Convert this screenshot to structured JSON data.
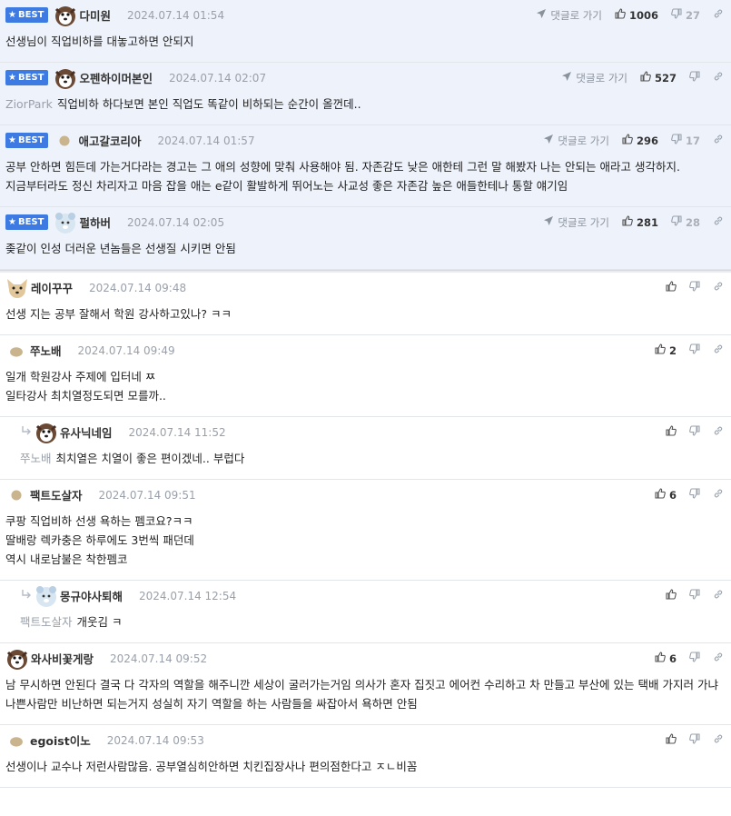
{
  "labels": {
    "best": "BEST",
    "goto": "댓글로 가기"
  },
  "best_comments": [
    {
      "nick": "다미원",
      "date": "2024.07.14 01:54",
      "up": "1006",
      "down": "27",
      "body": "선생님이 직업비하를 대놓고하면 안되지",
      "mention": "",
      "avatar": "dog"
    },
    {
      "nick": "오펜하이머본인",
      "date": "2024.07.14 02:07",
      "up": "527",
      "down": "",
      "body": "직업비하 하다보면 본인 직업도 똑같이 비하되는 순간이 올껀데..",
      "mention": "ZiorPark",
      "avatar": "dog"
    },
    {
      "nick": "애고갈코리아",
      "date": "2024.07.14 01:57",
      "up": "296",
      "down": "17",
      "body": "공부 안하면 힘든데 가는거다라는 경고는 그 애의 성향에 맞춰 사용해야 됨. 자존감도 낮은 애한테 그런 말 해봤자 나는 안되는 애라고 생각하지. 지금부터라도 정신 차리자고 마음 잡을 애는 e같이 활발하게 뛰어노는 사교성 좋은 자존감 높은 애들한테나 통할 얘기임",
      "mention": "",
      "avatar": "blob"
    },
    {
      "nick": "펄하버",
      "date": "2024.07.14 02:05",
      "up": "281",
      "down": "28",
      "body": "좆같이 인성 더러운 년놈들은 선생질 시키면 안됨",
      "mention": "",
      "avatar": "bear"
    }
  ],
  "comments": [
    {
      "nick": "레이꾸꾸",
      "date": "2024.07.14 09:48",
      "up": "",
      "body": "선생 지는 공부 잘해서 학원 강사하고있나? ㅋㅋ",
      "mention": "",
      "reply": false,
      "avatar": "fox"
    },
    {
      "nick": "쭈노배",
      "date": "2024.07.14 09:49",
      "up": "2",
      "body": "일개 학원강사 주제에 입터네 ㅉ\n일타강사 최치열정도되면 모를까..",
      "mention": "",
      "reply": false,
      "avatar": "blob2"
    },
    {
      "nick": "유사닉네임",
      "date": "2024.07.14 11:52",
      "up": "",
      "body": "최치열은 치열이 좋은 편이겠네.. 부럽다",
      "mention": "쭈노배",
      "reply": true,
      "avatar": "dog"
    },
    {
      "nick": "팩트도살자",
      "date": "2024.07.14 09:51",
      "up": "6",
      "body": "쿠팡 직업비하 선생 욕하는 펨코요?ㅋㅋ\n딸배랑 렉카충은 하루에도 3번씩 패던데\n역시 내로남불은 착한펨코",
      "mention": "",
      "reply": false,
      "avatar": "blob"
    },
    {
      "nick": "몽규야사퇴해",
      "date": "2024.07.14 12:54",
      "up": "",
      "body": "개웃김 ㅋ",
      "mention": "팩트도살자",
      "reply": true,
      "avatar": "bear"
    },
    {
      "nick": "와사비꽃게랑",
      "date": "2024.07.14 09:52",
      "up": "6",
      "body": "남 무시하면 안된다 결국 다 각자의 역할을 해주니깐 세상이 굴러가는거임 의사가 혼자 집짓고 에어컨 수리하고 차 만들고 부산에 있는 택배 가지러 가냐 나쁜사람만 비난하면 되는거지 성실히 자기 역할을 하는 사람들을 싸잡아서 욕하면 안됨",
      "mention": "",
      "reply": false,
      "avatar": "dog"
    },
    {
      "nick": "egoist이노",
      "date": "2024.07.14 09:53",
      "up": "",
      "body": "선생이나 교수나 저런사람많음. 공부열심히안하면 치킨집장사나 편의점한다고 ㅈㄴ비꼼",
      "mention": "",
      "reply": false,
      "avatar": "blob2"
    }
  ]
}
